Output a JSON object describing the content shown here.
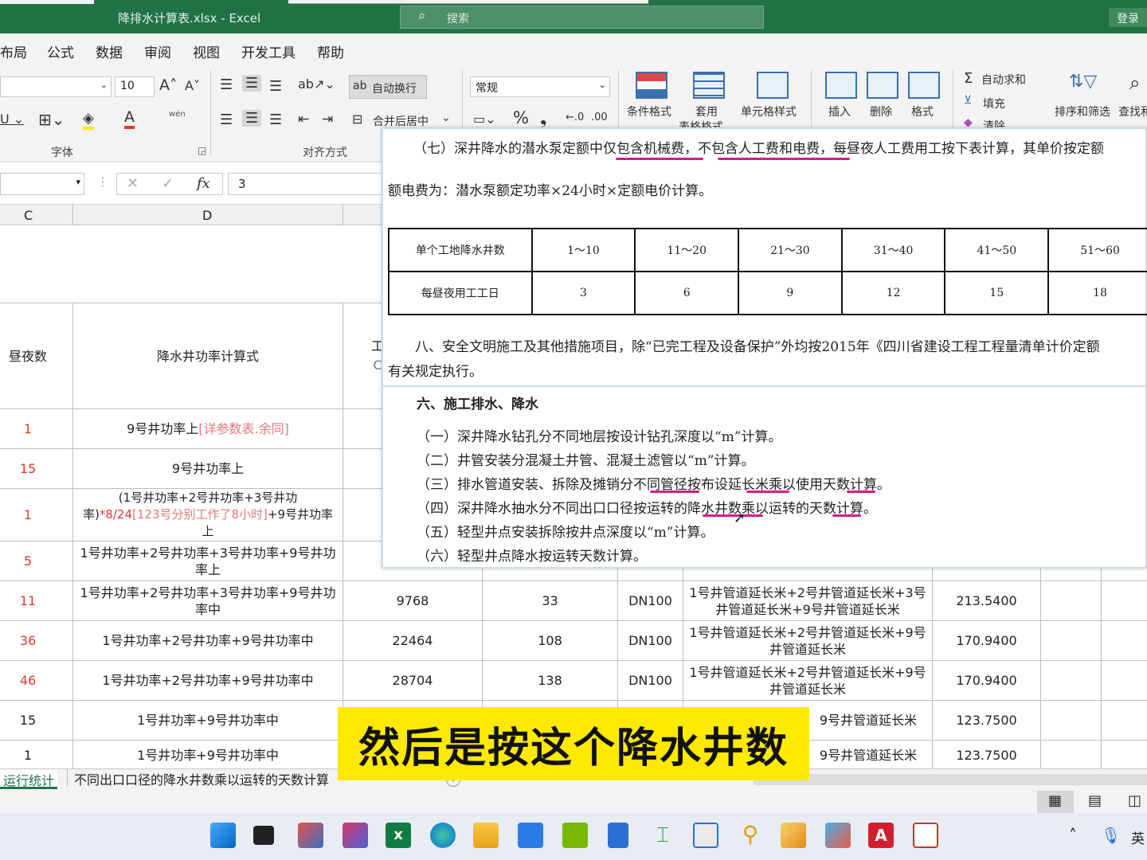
{
  "window": {
    "title": "降排水计算表.xlsx  -  Excel",
    "search_placeholder": "搜索",
    "login": "登录"
  },
  "menu": [
    "布局",
    "公式",
    "数据",
    "审阅",
    "视图",
    "开发工具",
    "帮助"
  ],
  "ribbon": {
    "font_size": "10",
    "wrap_text": "自动换行",
    "merge_center": "合并后居中",
    "number_format": "常规",
    "font_group": "字体",
    "align_group": "对齐方式",
    "conditional_format": "条件格式",
    "format_table": "套用",
    "format_table2": "表格格式",
    "cell_styles": "单元格样式",
    "insert": "插入",
    "delete": "删除",
    "format": "格式",
    "autosum": "自动求和",
    "fill": "填充",
    "clear": "清除",
    "sort_filter": "排序和筛选",
    "find_select": "查找和",
    "phonetic": "wén"
  },
  "formula_bar": {
    "value": "3",
    "fx": "fx"
  },
  "columns": [
    "C",
    "D"
  ],
  "headers": {
    "c": "昼夜数",
    "d": "降水井功率计算式",
    "e": "工",
    "e2": "C"
  },
  "rows": [
    {
      "c": "1",
      "d1": "9号井功率上",
      "d2": "[详参数表.余同]"
    },
    {
      "c": "15",
      "d1": "9号井功率上"
    },
    {
      "c": "1",
      "d1": "(1号井功率+2号井功率+3号井功",
      "d2a": "率)",
      "d2b": "*8/24",
      "d2c": "[123号分别工作了8小时]",
      "d2d": "+9号井功率",
      "d3": "上"
    },
    {
      "c": "5",
      "d1": "1号井功率+2号井功率+3号井功率+9号井功",
      "d2": "率上"
    },
    {
      "c": "11",
      "d1": "1号井功率+2号井功率+3号井功率+9号井功",
      "d2": "率中",
      "e": "9768",
      "f": "33",
      "g": "DN100",
      "h1": "1号井管道延长米+2号井管道延长米+3号",
      "h2": "井管道延长米+9号井管道延长米",
      "i": "213.5400"
    },
    {
      "c": "36",
      "d1": "1号井功率+2号井功率+9号井功率中",
      "e": "22464",
      "f": "108",
      "g": "DN100",
      "h1": "1号井管道延长米+2号井管道延长米+9号",
      "h2": "井管道延长米",
      "i": "170.9400"
    },
    {
      "c": "46",
      "d1": "1号井功率+2号井功率+9号井功率中",
      "e": "28704",
      "f": "138",
      "g": "DN100",
      "h1": "1号井管道延长米+2号井管道延长米+9号",
      "h2": "井管道延长米",
      "i": "170.9400"
    },
    {
      "c": "15",
      "d1": "1号井功率+9号井功率中",
      "h1": "9号井管道延长米",
      "i": "123.7500"
    },
    {
      "c": "1",
      "d1": "1号井功率+9号井功率中",
      "h1": "9号井管道延长米",
      "i": "123.7500"
    }
  ],
  "partial_row_text": "井管道延长米+9号井管道延长米",
  "doc": {
    "line1": "（七）深井降水的潜水泵定额中仅包含机械费，不包含人工费和电费，每昼夜人工费用工按下表计算，其单价按定额",
    "line2": "额电费为：潜水泵额定功率×24小时×定额电价计算。",
    "table": {
      "row1": [
        "单个工地降水井数",
        "1～10",
        "11～20",
        "21～30",
        "31～40",
        "41～50",
        "51～60"
      ],
      "row2": [
        "每昼夜用工工日",
        "3",
        "6",
        "9",
        "12",
        "15",
        "18"
      ]
    },
    "line3": "八、安全文明施工及其他措施项目，除“已完工程及设备保护”外均按2015年《四川省建设工程工程量清单计价定额",
    "line4": "有关规定执行。",
    "heading": "六、施工排水、降水",
    "items": [
      "（一）深井降水钻孔分不同地层按设计钻孔深度以“m”计算。",
      "（二）井管安装分混凝土井管、混凝土滤管以“m”计算。",
      "（三）排水管道安装、拆除及摊销分不同管径按布设延长米乘以使用天数计算。",
      "（四）深井降水抽水分不同出口口径按运转的降水井数乘以运转的天数计算。",
      "（五）轻型井点安装拆除按井点深度以“m”计算。",
      "（六）轻型井点降水按运转天数计算。"
    ]
  },
  "sheets": [
    "运行统计",
    "不同出口口径的降水井数乘以运转的天数计算"
  ],
  "subtitle": "然后是按这个降水井数",
  "taskbar": {
    "lang": "英"
  },
  "colors": {
    "excel_green": "#217346",
    "highlight": "#ffe900",
    "underline": "#d8198a"
  }
}
